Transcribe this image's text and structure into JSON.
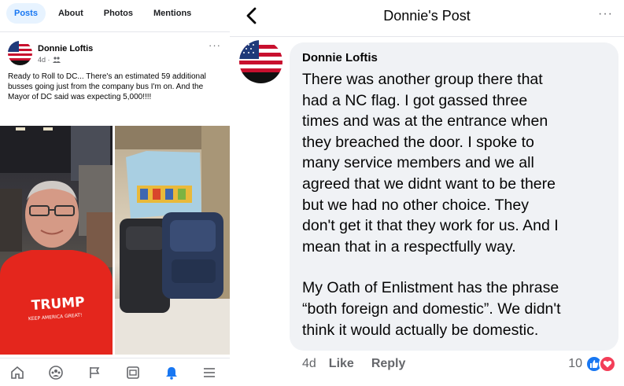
{
  "left": {
    "tabs": [
      "Posts",
      "About",
      "Photos",
      "Mentions"
    ],
    "author": "Donnie Loftis",
    "meta": "4d ·",
    "more": "···",
    "text": "Ready to Roll to DC... There's an estimated 59 additional busses going just from the company bus I'm on. And the Mayor of DC said was expecting 5,000!!!!",
    "shirt_text": "TRUMP",
    "shirt_subtext": "KEEP AMERICA GREAT!",
    "nav_icons": [
      "home-icon",
      "groups-icon",
      "pages-flag-icon",
      "feed-icon",
      "notifications-bell-icon",
      "menu-icon"
    ],
    "colors": {
      "accent": "#1877f2",
      "tab_bg": "#e7f3ff"
    }
  },
  "right": {
    "title": "Donnie's Post",
    "more": "···",
    "comment": {
      "author": "Donnie Loftis",
      "lines_p1": [
        "There was another group there that",
        "had a NC flag. I got gassed three",
        "times and was at the entrance when",
        "they breached the door. I spoke to",
        "many service members and we all",
        "agreed that we didnt want to be there",
        "but we had no other choice. They",
        "don't get it that they work for us. And I",
        "mean that in a respectfully way."
      ],
      "lines_p2": [
        "My Oath of Enlistment has the phrase",
        "“both foreign and domestic”. We didn't",
        "think it would actually be domestic."
      ]
    },
    "actions": {
      "time": "4d",
      "like": "Like",
      "reply": "Reply"
    },
    "reaction_count": "10",
    "colors": {
      "like_blue": "#1877f2",
      "love_red": "#f33e58",
      "bubble_bg": "#f0f2f5"
    }
  }
}
